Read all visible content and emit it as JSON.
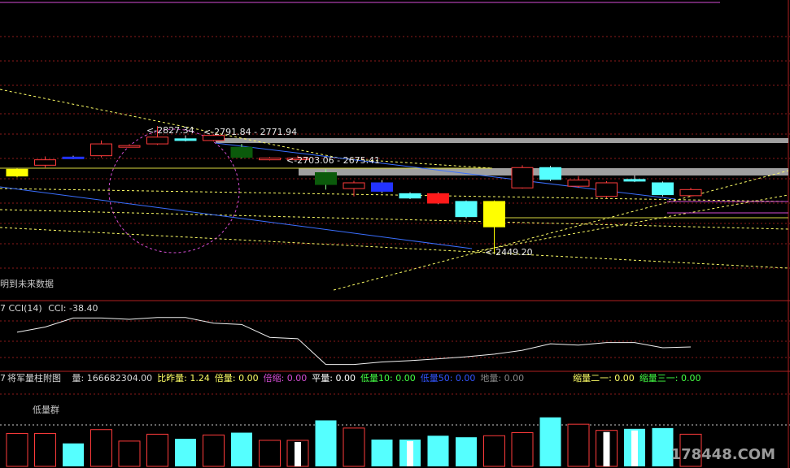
{
  "colors": {
    "up": "#ff3b3b",
    "down_cyan": "#55ffff",
    "down_green": "#0b5a0b",
    "yellow": "#ffff00",
    "blue": "#3a6fff",
    "dashed_yellow": "#ffff66",
    "magenta": "#d34dd3",
    "grid_red": "#8b1a1a",
    "gray_band": "#a0a0a0"
  },
  "main": {
    "note_text": "明到未来数据",
    "labels": {
      "high_a": "2827.34",
      "range_a": "2791.84 - 2771.94",
      "range_b": "2703.06 - 2675.41",
      "low_a": "2449.20"
    }
  },
  "cci": {
    "title": "CCI(14)",
    "value_text": "CCI: -38.40",
    "prefix": "7"
  },
  "volume": {
    "prefix": "7",
    "title": "将军量柱附图",
    "items": [
      {
        "label": "量: 166682304.00",
        "color": "#d8d8d8"
      },
      {
        "label": "比昨量: 1.24",
        "color": "#ffff66"
      },
      {
        "label": "倍量: 0.00",
        "color": "#ffff66"
      },
      {
        "label": "倍缩: 0.00",
        "color": "#d34dd3"
      },
      {
        "label": "平量: 0.00",
        "color": "#ffffff"
      },
      {
        "label": "低量10: 0.00",
        "color": "#44ff44"
      },
      {
        "label": "低量50: 0.00",
        "color": "#3355ff"
      },
      {
        "label": "地量: 0.00",
        "color": "#888888"
      },
      {
        "label": "缩量二一: 0.00",
        "color": "#ffff66"
      },
      {
        "label": "缩量三一: 0.00",
        "color": "#44ff44"
      }
    ],
    "group_label": "低量群"
  },
  "watermark": "178448.COM",
  "chart_data": [
    {
      "type": "candlestick",
      "title": "",
      "candles": [
        {
          "o": 2700,
          "c": 2680,
          "h": 2702,
          "l": 2676,
          "style": "yellow"
        },
        {
          "o": 2712,
          "c": 2728,
          "h": 2738,
          "l": 2705,
          "style": "up"
        },
        {
          "o": 2736,
          "c": 2733,
          "h": 2740,
          "l": 2730,
          "style": "blue"
        },
        {
          "o": 2740,
          "c": 2775,
          "h": 2785,
          "l": 2735,
          "style": "up"
        },
        {
          "o": 2768,
          "c": 2770,
          "h": 2774,
          "l": 2764,
          "style": "up"
        },
        {
          "o": 2775,
          "c": 2795,
          "h": 2827.34,
          "l": 2772,
          "style": "up"
        },
        {
          "o": 2790,
          "c": 2785,
          "h": 2800,
          "l": 2782,
          "style": "cyan"
        },
        {
          "o": 2785,
          "c": 2800,
          "h": 2803,
          "l": 2782,
          "style": "up"
        },
        {
          "o": 2765,
          "c": 2735,
          "h": 2775,
          "l": 2732,
          "style": "green"
        },
        {
          "o": 2728,
          "c": 2733,
          "h": 2736,
          "l": 2726,
          "style": "up"
        },
        {
          "o": 2730,
          "c": 2733,
          "h": 2740,
          "l": 2728,
          "style": "up"
        },
        {
          "o": 2690,
          "c": 2655,
          "h": 2700,
          "l": 2640,
          "style": "green"
        },
        {
          "o": 2643,
          "c": 2660,
          "h": 2666,
          "l": 2620,
          "style": "up"
        },
        {
          "o": 2660,
          "c": 2635,
          "h": 2668,
          "l": 2630,
          "style": "blue"
        },
        {
          "o": 2628,
          "c": 2615,
          "h": 2632,
          "l": 2612,
          "style": "cyan"
        },
        {
          "o": 2628,
          "c": 2600,
          "h": 2632,
          "l": 2597,
          "style": "red"
        },
        {
          "o": 2605,
          "c": 2560,
          "h": 2608,
          "l": 2555,
          "style": "cyan"
        },
        {
          "o": 2605,
          "c": 2530,
          "h": 2608,
          "l": 2449.2,
          "style": "yellow"
        },
        {
          "o": 2645,
          "c": 2705,
          "h": 2712,
          "l": 2643,
          "style": "up"
        },
        {
          "o": 2705,
          "c": 2670,
          "h": 2710,
          "l": 2665,
          "style": "cyan"
        },
        {
          "o": 2650,
          "c": 2668,
          "h": 2680,
          "l": 2645,
          "style": "up"
        },
        {
          "o": 2620,
          "c": 2660,
          "h": 2665,
          "l": 2615,
          "style": "up"
        },
        {
          "o": 2670,
          "c": 2665,
          "h": 2682,
          "l": 2662,
          "style": "cyan"
        },
        {
          "o": 2660,
          "c": 2625,
          "h": 2664,
          "l": 2620,
          "style": "cyan"
        },
        {
          "o": 2622,
          "c": 2640,
          "h": 2645,
          "l": 2618,
          "style": "up"
        }
      ]
    },
    {
      "type": "line",
      "title": "CCI(14)",
      "values": [
        -15,
        5,
        40,
        40,
        35,
        42,
        42,
        20,
        15,
        -35,
        -40,
        -140,
        -140,
        -130,
        -125,
        -118,
        -110,
        -100,
        -85,
        -60,
        -65,
        -55,
        -55,
        -75,
        -72
      ]
    },
    {
      "type": "bar",
      "title": "将军量柱附图",
      "values": [
        43,
        43,
        30,
        48,
        33,
        42,
        36,
        41,
        44,
        34,
        34,
        60,
        50,
        35,
        35,
        40,
        38,
        40,
        44,
        64,
        55,
        47,
        49,
        50,
        42
      ],
      "styles": [
        "up",
        "up",
        "cyan",
        "up",
        "up",
        "up",
        "cyan",
        "up",
        "cyan",
        "up",
        "white",
        "cyan",
        "up",
        "cyan",
        "cyanw",
        "cyan",
        "cyan",
        "up",
        "up",
        "cyan",
        "up",
        "white",
        "cyanw",
        "cyan",
        "up"
      ]
    }
  ]
}
